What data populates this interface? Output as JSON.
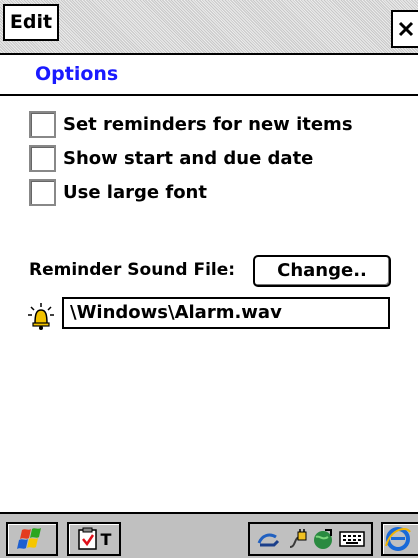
{
  "topbar": {
    "menu_label": "Edit",
    "close_icon": "close-x"
  },
  "header": {
    "title": "Options"
  },
  "options": [
    {
      "label": "Set reminders for new items",
      "checked": false
    },
    {
      "label": "Show start and due date",
      "checked": false
    },
    {
      "label": "Use large font",
      "checked": false
    }
  ],
  "sound": {
    "label": "Reminder Sound File:",
    "button_label": "Change..",
    "file_path": "\\Windows\\Alarm.wav",
    "icon": "bell-icon"
  },
  "taskbar": {
    "start_icon": "windows-flag",
    "task_label": "T",
    "task_icon": "tasks-checkbox",
    "tray_icons": [
      "sync-icon",
      "power-plug-icon",
      "network-icon",
      "keyboard-icon"
    ],
    "ie_icon": "internet-explorer"
  }
}
